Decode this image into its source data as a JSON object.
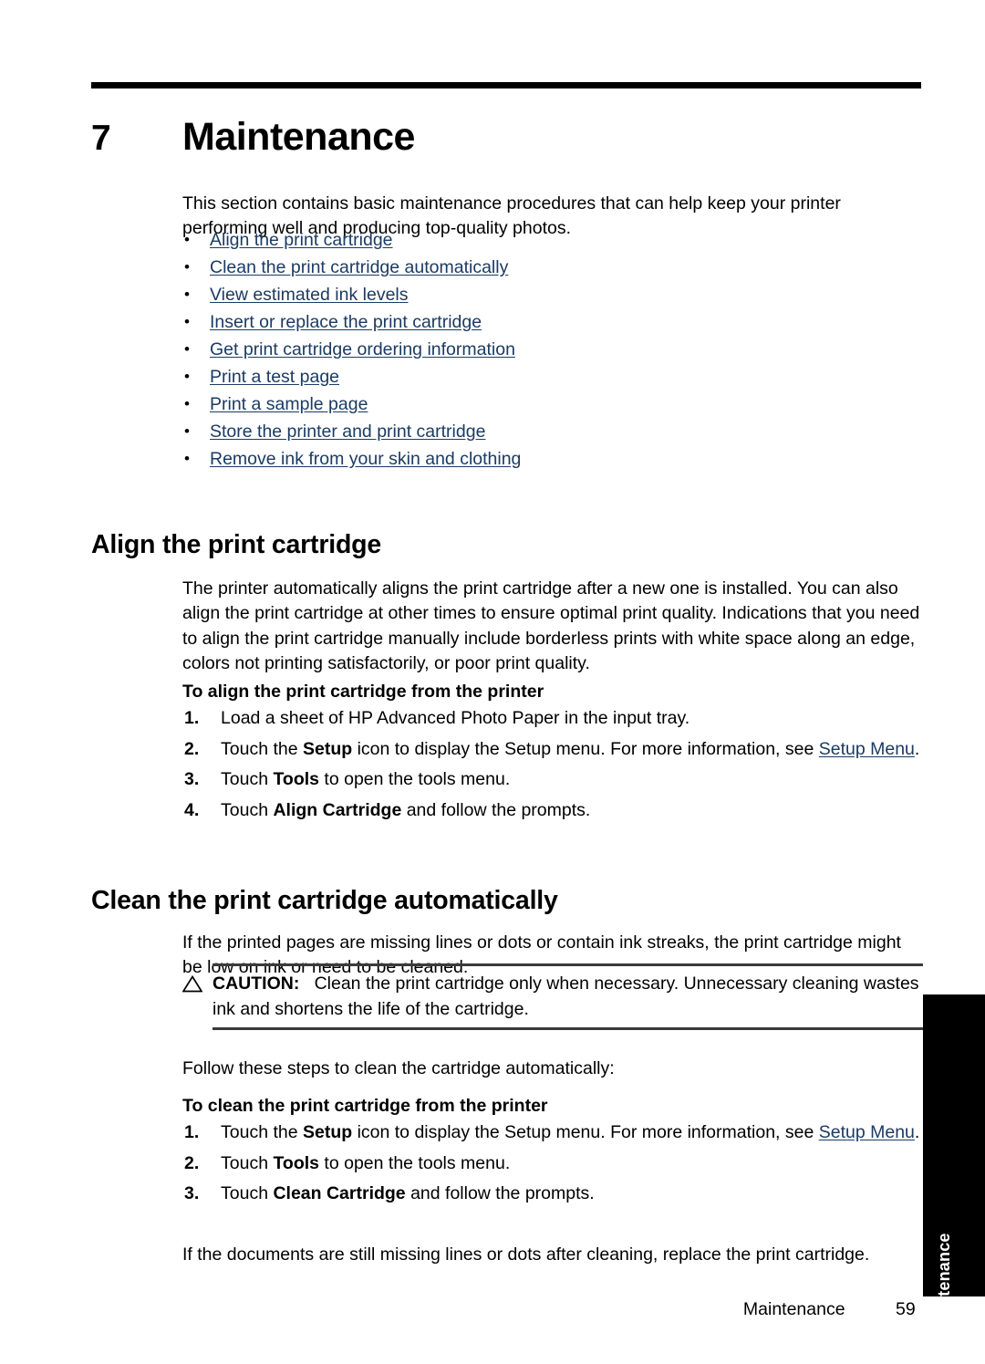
{
  "document": {
    "chapter_number": "7",
    "chapter_title": "Maintenance"
  },
  "intro": {
    "text": "This section contains basic maintenance procedures that can help keep your printer performing well and producing top-quality photos."
  },
  "toc": {
    "bullet_glyph": "•",
    "items": [
      {
        "label": "Align the print cartridge"
      },
      {
        "label": "Clean the print cartridge automatically"
      },
      {
        "label": "View estimated ink levels"
      },
      {
        "label": "Insert or replace the print cartridge"
      },
      {
        "label": "Get print cartridge ordering information"
      },
      {
        "label": "Print a test page"
      },
      {
        "label": "Print a sample page"
      },
      {
        "label": "Store the printer and print cartridge"
      },
      {
        "label": "Remove ink from your skin and clothing"
      }
    ]
  },
  "sections": {
    "align": {
      "heading": "Align the print cartridge",
      "paragraph": "The printer automatically aligns the print cartridge after a new one is installed. You can also align the print cartridge at other times to ensure optimal print quality. Indications that you need to align the print cartridge manually include borderless prints with white space along an edge, colors not printing satisfactorily, or poor print quality.",
      "procedure_title": "To align the print cartridge from the printer",
      "steps": [
        {
          "num": "1.",
          "pre": "Load a sheet of HP Advanced Photo Paper in the input tray.",
          "bold": "",
          "post": "",
          "link": "",
          "tail": ""
        },
        {
          "num": "2.",
          "pre": "Touch the ",
          "bold": "Setup",
          "post": " icon to display the Setup menu. For more information, see ",
          "link": "Setup Menu",
          "tail": "."
        },
        {
          "num": "3.",
          "pre": "Touch ",
          "bold": "Tools",
          "post": " to open the tools menu.",
          "link": "",
          "tail": ""
        },
        {
          "num": "4.",
          "pre": "Touch ",
          "bold": "Align Cartridge",
          "post": " and follow the prompts.",
          "link": "",
          "tail": ""
        }
      ]
    },
    "clean": {
      "heading": "Clean the print cartridge automatically",
      "paragraph": "If the printed pages are missing lines or dots or contain ink streaks, the print cartridge might be low on ink or need to be cleaned.",
      "caution": {
        "icon": "warning-triangle-icon",
        "label": "CAUTION:",
        "text": "Clean the print cartridge only when necessary. Unnecessary cleaning wastes ink and shortens the life of the cartridge."
      },
      "follow_paragraph": "Follow these steps to clean the cartridge automatically:",
      "procedure_title": "To clean the print cartridge from the printer",
      "steps": [
        {
          "num": "1.",
          "pre": "Touch the ",
          "bold": "Setup",
          "post": " icon to display the Setup menu. For more information, see ",
          "link": "Setup Menu",
          "tail": "."
        },
        {
          "num": "2.",
          "pre": "Touch ",
          "bold": "Tools",
          "post": " to open the tools menu.",
          "link": "",
          "tail": ""
        },
        {
          "num": "3.",
          "pre": "Touch ",
          "bold": "Clean Cartridge",
          "post": " and follow the prompts.",
          "link": "",
          "tail": ""
        }
      ],
      "after_paragraph": "If the documents are still missing lines or dots after cleaning, replace the print cartridge."
    }
  },
  "thumb_tab": {
    "label": "Maintenance"
  },
  "footer": {
    "section": "Maintenance",
    "page_number": "59"
  },
  "colors": {
    "link": "#1b3b63",
    "rule": "#000000",
    "tab_background": "#000000",
    "tab_text": "#ffffff"
  }
}
